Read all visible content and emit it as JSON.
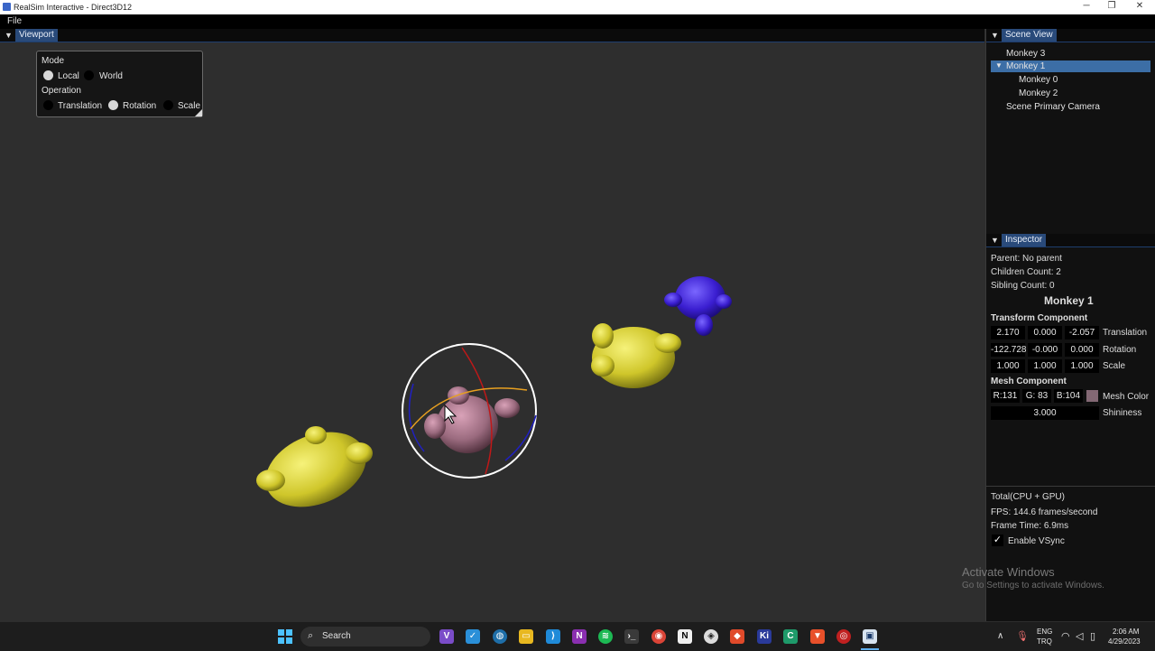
{
  "window": {
    "title": "RealSim Interactive - Direct3D12",
    "minimize": "─",
    "maximize": "❐",
    "close": "✕"
  },
  "menu": {
    "file": "File"
  },
  "viewport": {
    "tab": "Viewport",
    "mode_label": "Mode",
    "mode_options": [
      "Local",
      "World"
    ],
    "mode_selected": "Local",
    "operation_label": "Operation",
    "operation_options": [
      "Translation",
      "Rotation",
      "Scale"
    ],
    "operation_selected": "Rotation"
  },
  "scene_view": {
    "tab": "Scene View",
    "items": [
      {
        "label": "Monkey 3"
      },
      {
        "label": "Monkey 1",
        "selected": true,
        "expanded": true
      },
      {
        "label": "Monkey 0"
      },
      {
        "label": "Monkey 2"
      },
      {
        "label": "Scene Primary Camera"
      }
    ]
  },
  "inspector": {
    "tab": "Inspector",
    "parent": "Parent: No parent",
    "children": "Children Count: 2",
    "siblings": "Sibling Count: 0",
    "name": "Monkey 1",
    "transform_title": "Transform Component",
    "translation": [
      "2.170",
      "0.000",
      "-2.057"
    ],
    "translation_label": "Translation",
    "rotation": [
      "-122.728",
      "-0.000",
      "0.000"
    ],
    "rotation_label": "Rotation",
    "scale": [
      "1.000",
      "1.000",
      "1.000"
    ],
    "scale_label": "Scale",
    "mesh_title": "Mesh Component",
    "color_r": "R:131",
    "color_g": "G: 83",
    "color_b": "B:104",
    "mesh_color_label": "Mesh Color",
    "mesh_color_hex": "#836874",
    "shininess": "3.000",
    "shininess_label": "Shininess"
  },
  "stats": {
    "title": "Total(CPU + GPU)",
    "fps": "FPS: 144.6 frames/second",
    "frame_time": "Frame Time: 6.9ms",
    "vsync_label": "Enable VSync",
    "vsync_checked": true
  },
  "watermark": {
    "line1": "Activate Windows",
    "line2": "Go to Settings to activate Windows."
  },
  "taskbar": {
    "search": "Search",
    "lang1": "ENG",
    "lang2": "TRQ",
    "time": "2:06 AM",
    "date": "4/29/2023"
  }
}
